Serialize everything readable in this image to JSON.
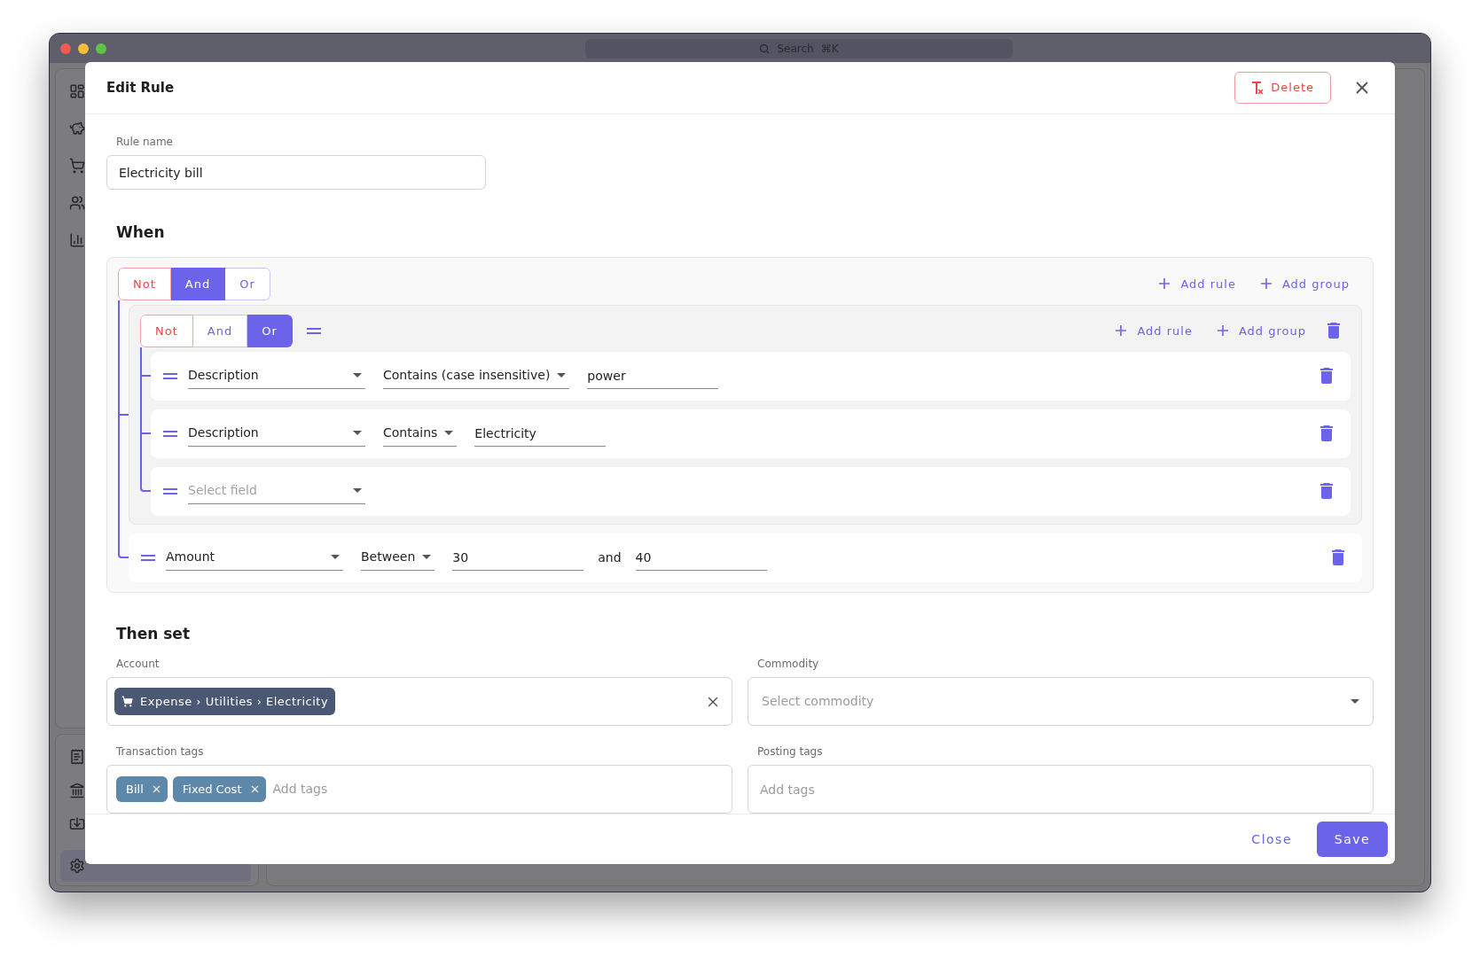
{
  "window": {
    "search": "Search",
    "shortcut": "⌘K"
  },
  "dialog": {
    "title": "Edit Rule",
    "delete_label": "Delete"
  },
  "rule_name": {
    "label": "Rule name",
    "value": "Electricity bill"
  },
  "when": {
    "heading": "When",
    "group": {
      "combinators": [
        {
          "label": "Not",
          "kind": "negate",
          "selected": false
        },
        {
          "label": "And",
          "kind": "join",
          "selected": true
        },
        {
          "label": "Or",
          "kind": "join",
          "selected": false
        }
      ],
      "add_rule": "Add rule",
      "add_group": "Add group",
      "items": [
        {
          "kind": "group",
          "combinators": [
            {
              "label": "Not",
              "kind": "negate",
              "selected": false
            },
            {
              "label": "And",
              "kind": "join",
              "selected": false
            },
            {
              "label": "Or",
              "kind": "join",
              "selected": true
            }
          ],
          "add_rule": "Add rule",
          "add_group": "Add group",
          "items": [
            {
              "kind": "rule",
              "field": "Description",
              "operator": "Contains (case insensitive)",
              "values": [
                "power"
              ]
            },
            {
              "kind": "rule",
              "field": "Description",
              "operator": "Contains",
              "values": [
                "Electricity"
              ]
            },
            {
              "kind": "rule",
              "field_placeholder": "Select field"
            }
          ]
        },
        {
          "kind": "rule",
          "field": "Amount",
          "operator": "Between",
          "values": [
            "30",
            "40"
          ],
          "joiner": "and"
        }
      ]
    }
  },
  "then_set": {
    "heading": "Then set",
    "account": {
      "label": "Account",
      "value": "Expense › Utilities › Electricity"
    },
    "commodity": {
      "label": "Commodity",
      "placeholder": "Select commodity"
    },
    "transaction_tags": {
      "label": "Transaction tags",
      "tags": [
        "Bill",
        "Fixed Cost"
      ],
      "placeholder": "Add tags"
    },
    "posting_tags": {
      "label": "Posting tags",
      "placeholder": "Add tags"
    }
  },
  "footer": {
    "close": "Close",
    "save": "Save"
  }
}
